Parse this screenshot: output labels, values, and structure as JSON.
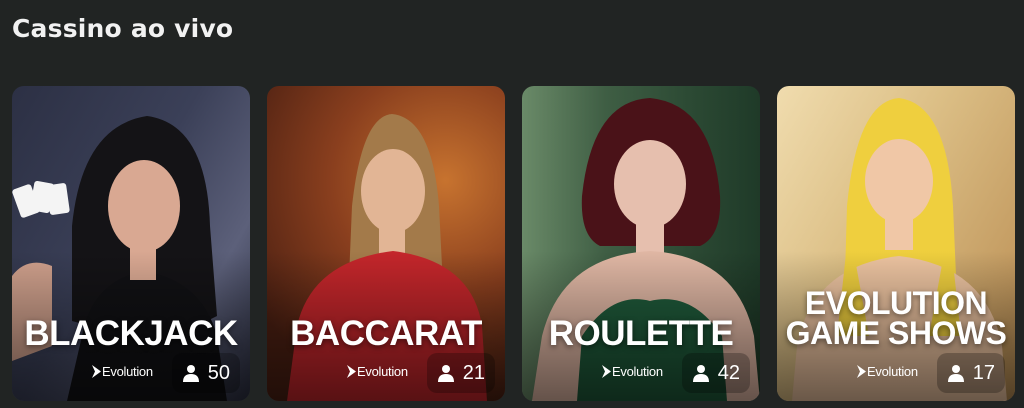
{
  "section": {
    "title": "Cassino ao vivo"
  },
  "cards": [
    {
      "name": "BLACKJACK",
      "provider": "Evolution",
      "players": "50",
      "icon": "user-icon",
      "colors": {
        "bg_top": "#3a3f55",
        "bg_bottom": "#1b1d2a",
        "accent": "#6a6e8a"
      }
    },
    {
      "name": "BACCARAT",
      "provider": "Evolution",
      "players": "21",
      "icon": "user-icon",
      "colors": {
        "bg_top": "#7a3d22",
        "bg_bottom": "#3a1a12",
        "accent": "#c4562d"
      }
    },
    {
      "name": "ROULETTE",
      "provider": "Evolution",
      "players": "42",
      "icon": "user-icon",
      "colors": {
        "bg_top": "#4d6a4a",
        "bg_bottom": "#1f3a26",
        "accent": "#3e7a52"
      }
    },
    {
      "name_line1": "EVOLUTION",
      "name_line2": "GAME SHOWS",
      "provider": "Evolution",
      "players": "17",
      "icon": "user-icon",
      "colors": {
        "bg_top": "#e8cf9a",
        "bg_bottom": "#b98a4e",
        "accent": "#f1d24c"
      }
    }
  ]
}
